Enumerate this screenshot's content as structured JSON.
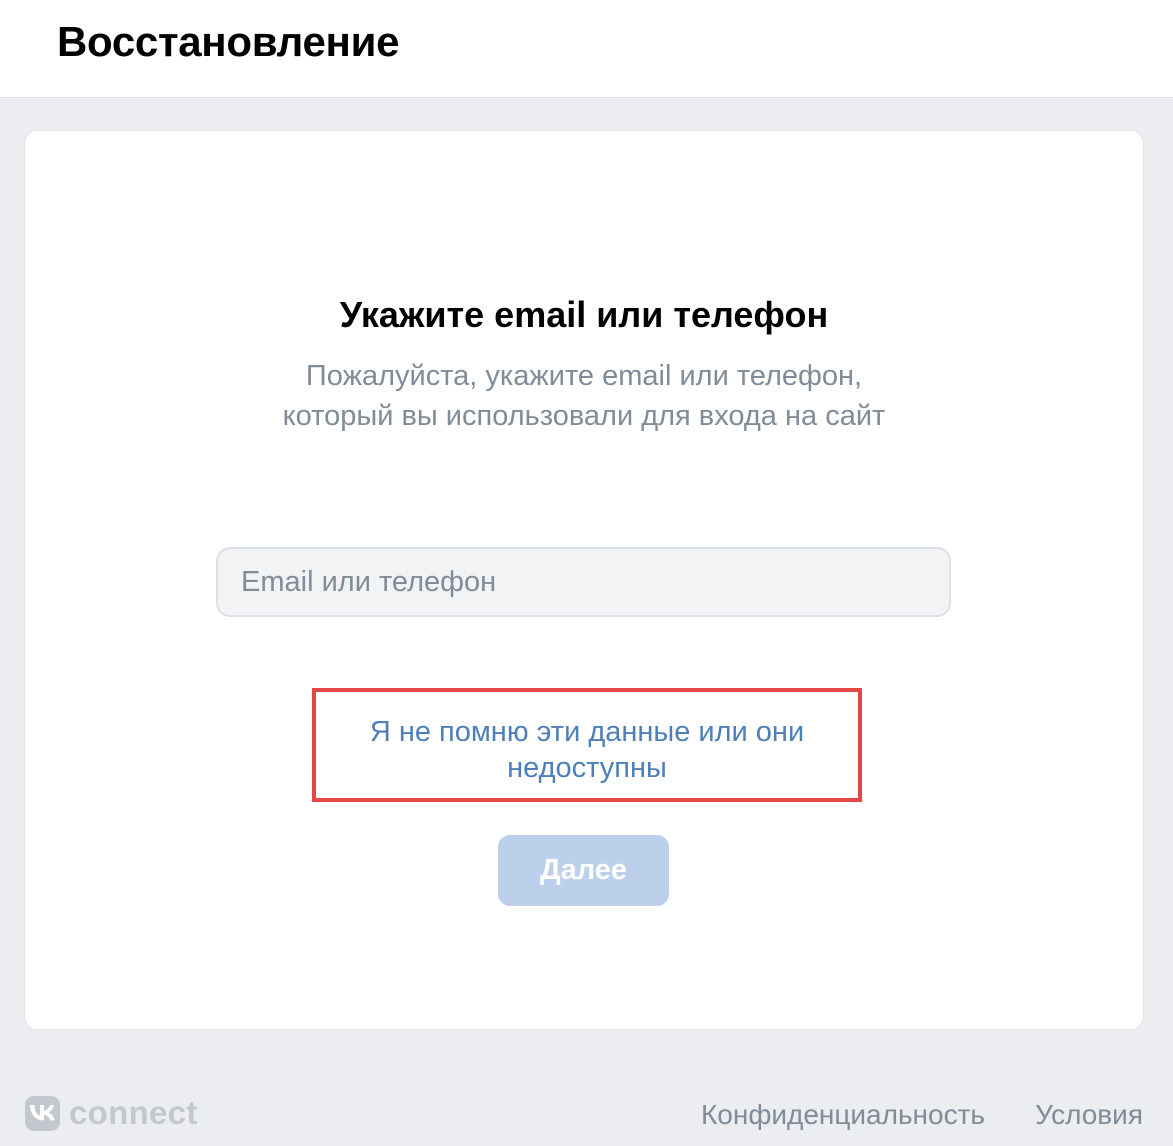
{
  "header": {
    "title": "Восстановление"
  },
  "form": {
    "title": "Укажите email или телефон",
    "subtitle": "Пожалуйста, укажите email или телефон, который вы использовали для входа на сайт",
    "input_placeholder": "Email или телефон",
    "input_value": "",
    "forgot_link": "Я не помню эти данные или они недоступны",
    "next_button": "Далее"
  },
  "footer": {
    "logo_text": "connect",
    "logo_icon": "vk-logo-icon",
    "privacy_link": "Конфиденциальность",
    "terms_link": "Условия"
  },
  "colors": {
    "background": "#ebedf0",
    "link": "#4f7fb8",
    "highlight_border": "#e64646",
    "button_disabled": "#bcd0eb",
    "secondary_text": "#818c99"
  }
}
